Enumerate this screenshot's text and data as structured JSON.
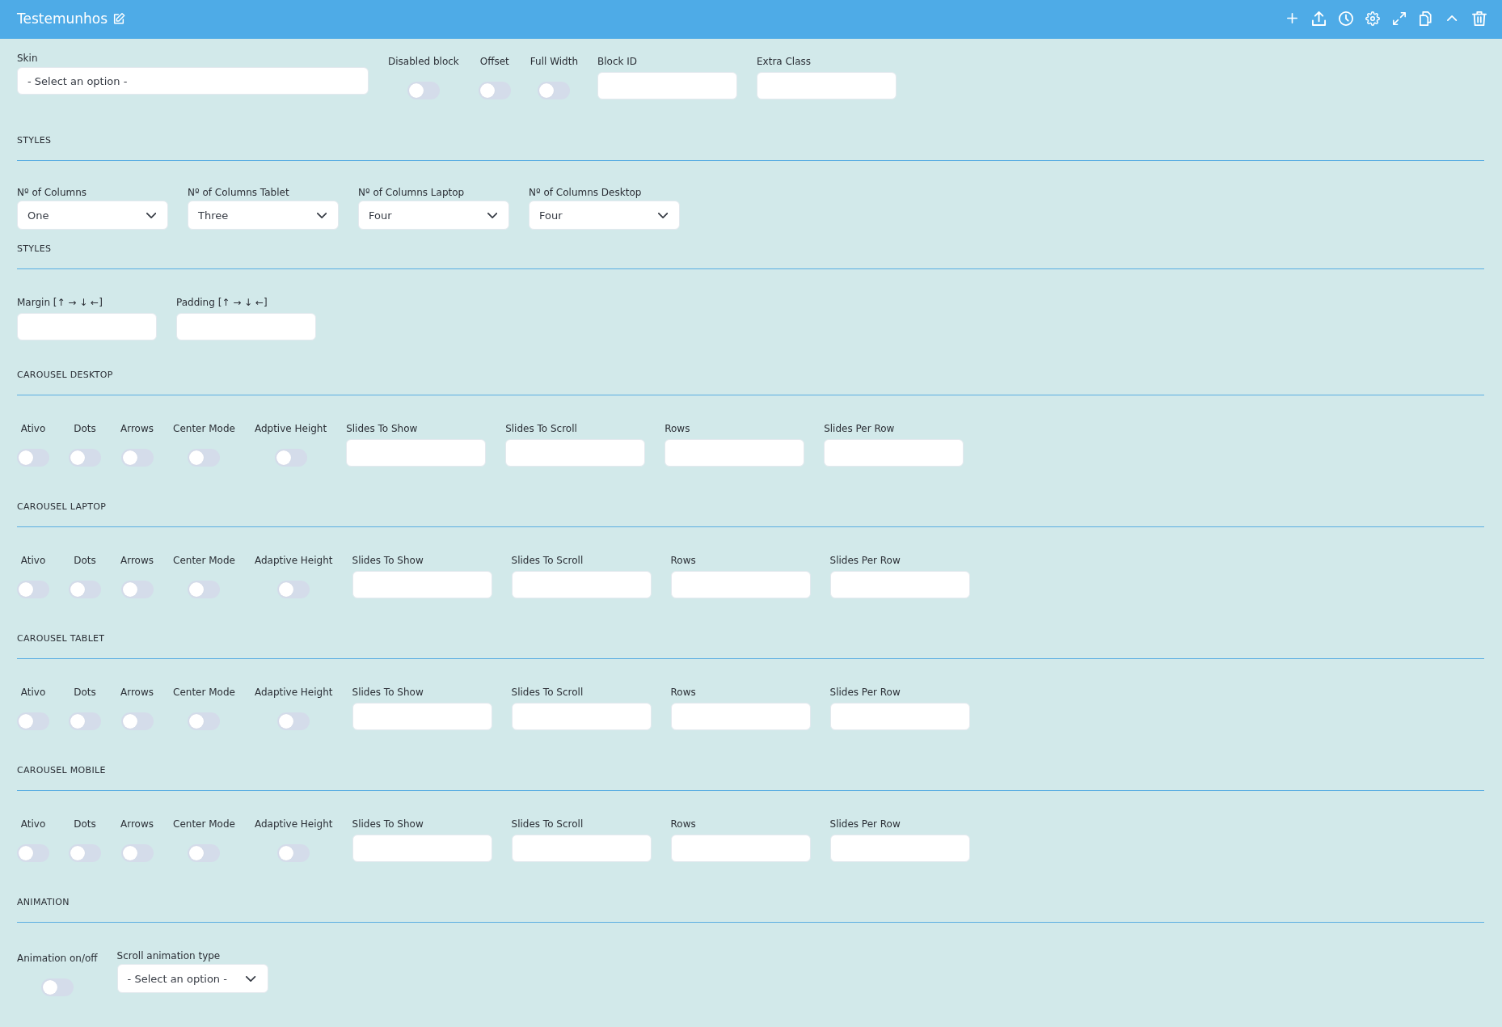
{
  "block": {
    "title": "Testemunhos"
  },
  "sections": [
    {
      "kind": "general",
      "controls": [
        {
          "kind": "search-select",
          "label": "Skin",
          "value": "- Select an option -"
        },
        {
          "kind": "toggle",
          "label": "Disabled block",
          "on": false
        },
        {
          "kind": "toggle",
          "label": "Offset",
          "on": false
        },
        {
          "kind": "toggle",
          "label": "Full Width",
          "on": false
        },
        {
          "kind": "input",
          "label": "Block ID"
        },
        {
          "kind": "input",
          "label": "Extra Class"
        }
      ]
    },
    {
      "kind": "columns",
      "heading": "STYLES",
      "controls": [
        {
          "kind": "select",
          "label": "Nº of Columns",
          "value": "One"
        },
        {
          "kind": "select",
          "label": "Nº of Columns Tablet",
          "value": "Three"
        },
        {
          "kind": "select",
          "label": "Nº of Columns Laptop",
          "value": "Four"
        },
        {
          "kind": "select",
          "label": "Nº of Columns Desktop",
          "value": "Four"
        }
      ]
    },
    {
      "kind": "spacing",
      "heading": "STYLES",
      "controls": [
        {
          "kind": "input",
          "label": "Margin [↑ → ↓ ←]"
        },
        {
          "kind": "input",
          "label": "Padding [↑ → ↓ ←]"
        }
      ]
    },
    {
      "kind": "carousel",
      "heading": "CAROUSEL DESKTOP",
      "controls": [
        {
          "kind": "toggle",
          "label": "Ativo",
          "on": false
        },
        {
          "kind": "toggle",
          "label": "Dots",
          "on": false
        },
        {
          "kind": "toggle",
          "label": "Arrows",
          "on": false
        },
        {
          "kind": "toggle",
          "label": "Center Mode",
          "on": false
        },
        {
          "kind": "toggle",
          "label": "Adptive Height",
          "on": false
        },
        {
          "kind": "input",
          "label": "Slides To Show"
        },
        {
          "kind": "input",
          "label": "Slides To Scroll"
        },
        {
          "kind": "input",
          "label": "Rows"
        },
        {
          "kind": "input",
          "label": "Slides Per Row"
        }
      ]
    },
    {
      "kind": "carousel",
      "heading": "CAROUSEL LAPTOP",
      "controls": [
        {
          "kind": "toggle",
          "label": "Ativo",
          "on": false
        },
        {
          "kind": "toggle",
          "label": "Dots",
          "on": false
        },
        {
          "kind": "toggle",
          "label": "Arrows",
          "on": false
        },
        {
          "kind": "toggle",
          "label": "Center Mode",
          "on": false
        },
        {
          "kind": "toggle",
          "label": "Adaptive Height",
          "on": false
        },
        {
          "kind": "input",
          "label": "Slides To Show"
        },
        {
          "kind": "input",
          "label": "Slides To Scroll"
        },
        {
          "kind": "input",
          "label": "Rows"
        },
        {
          "kind": "input",
          "label": "Slides Per Row"
        }
      ]
    },
    {
      "kind": "carousel",
      "heading": "CAROUSEL TABLET",
      "controls": [
        {
          "kind": "toggle",
          "label": "Ativo",
          "on": false
        },
        {
          "kind": "toggle",
          "label": "Dots",
          "on": false
        },
        {
          "kind": "toggle",
          "label": "Arrows",
          "on": false
        },
        {
          "kind": "toggle",
          "label": "Center Mode",
          "on": false
        },
        {
          "kind": "toggle",
          "label": "Adaptive Height",
          "on": false
        },
        {
          "kind": "input",
          "label": "Slides To Show"
        },
        {
          "kind": "input",
          "label": "Slides To Scroll"
        },
        {
          "kind": "input",
          "label": "Rows"
        },
        {
          "kind": "input",
          "label": "Slides Per Row"
        }
      ]
    },
    {
      "kind": "carousel",
      "heading": "CAROUSEL MOBILE",
      "controls": [
        {
          "kind": "toggle",
          "label": "Ativo",
          "on": false
        },
        {
          "kind": "toggle",
          "label": "Dots",
          "on": false
        },
        {
          "kind": "toggle",
          "label": "Arrows",
          "on": false
        },
        {
          "kind": "toggle",
          "label": "Center Mode",
          "on": false
        },
        {
          "kind": "toggle",
          "label": "Adaptive Height",
          "on": false
        },
        {
          "kind": "input",
          "label": "Slides To Show"
        },
        {
          "kind": "input",
          "label": "Slides To Scroll"
        },
        {
          "kind": "input",
          "label": "Rows"
        },
        {
          "kind": "input",
          "label": "Slides Per Row"
        }
      ]
    },
    {
      "kind": "animation",
      "heading": "ANIMATION",
      "controls": [
        {
          "kind": "toggle",
          "label": "Animation on/off",
          "on": false
        },
        {
          "kind": "select",
          "label": "Scroll animation type",
          "value": "- Select an option -"
        }
      ]
    }
  ]
}
